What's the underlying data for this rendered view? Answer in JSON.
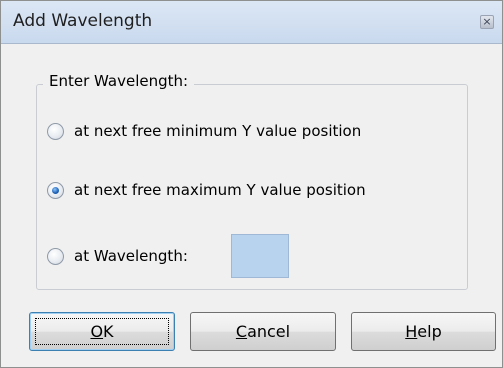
{
  "window": {
    "title": "Add Wavelength",
    "close_icon": "close-icon"
  },
  "group": {
    "label": "Enter Wavelength:"
  },
  "options": [
    {
      "label": "at next free minimum Y value position",
      "selected": false
    },
    {
      "label": "at next free maximum Y value position",
      "selected": true
    },
    {
      "label": "at Wavelength:",
      "selected": false
    }
  ],
  "wavelength_input": {
    "value": ""
  },
  "buttons": {
    "ok": {
      "mnemonic": "O",
      "rest": "K"
    },
    "cancel": {
      "mnemonic": "C",
      "rest": "ancel"
    },
    "help": {
      "mnemonic": "H",
      "rest": "elp"
    }
  },
  "colors": {
    "input_fill": "#b8d3ee",
    "radio_selected": "#1a5fb4"
  }
}
